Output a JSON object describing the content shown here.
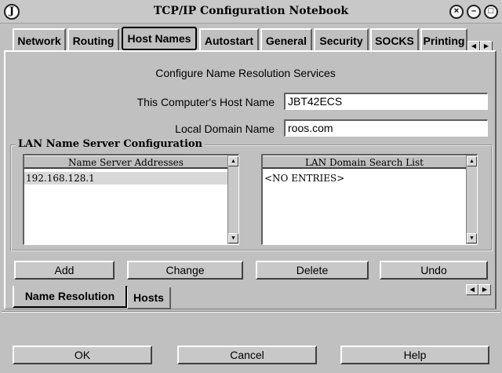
{
  "window": {
    "title": "TCP/IP Configuration Notebook",
    "app_icon_letter": "J",
    "controls": {
      "close": "×",
      "minimize": "–",
      "maximize": "□"
    }
  },
  "tabs": [
    {
      "label": "Network"
    },
    {
      "label": "Routing"
    },
    {
      "label": "Host Names",
      "active": true
    },
    {
      "label": "Autostart"
    },
    {
      "label": "General"
    },
    {
      "label": "Security"
    },
    {
      "label": "SOCKS"
    },
    {
      "label": "Printing"
    }
  ],
  "tab_scroll": {
    "left": "◀",
    "right": "▶"
  },
  "page": {
    "heading": "Configure Name Resolution Services",
    "host_name_label": "This Computer's Host Name",
    "host_name_value": "JBT42ECS",
    "domain_label": "Local Domain Name",
    "domain_value": "roos.com",
    "group_title": "LAN Name Server Configuration",
    "name_servers": {
      "header": "Name Server Addresses",
      "items": [
        "192.168.128.1"
      ]
    },
    "search_list": {
      "header": "LAN Domain Search List",
      "items": [
        "<NO ENTRIES>"
      ]
    },
    "scroll": {
      "up": "▲",
      "down": "▼"
    },
    "buttons": {
      "add": "Add",
      "change": "Change",
      "delete": "Delete",
      "undo": "Undo"
    }
  },
  "bottom_tabs": [
    {
      "label": "Name Resolution",
      "active": true
    },
    {
      "label": "Hosts"
    }
  ],
  "footer": {
    "ok": "OK",
    "cancel": "Cancel",
    "help": "Help"
  }
}
